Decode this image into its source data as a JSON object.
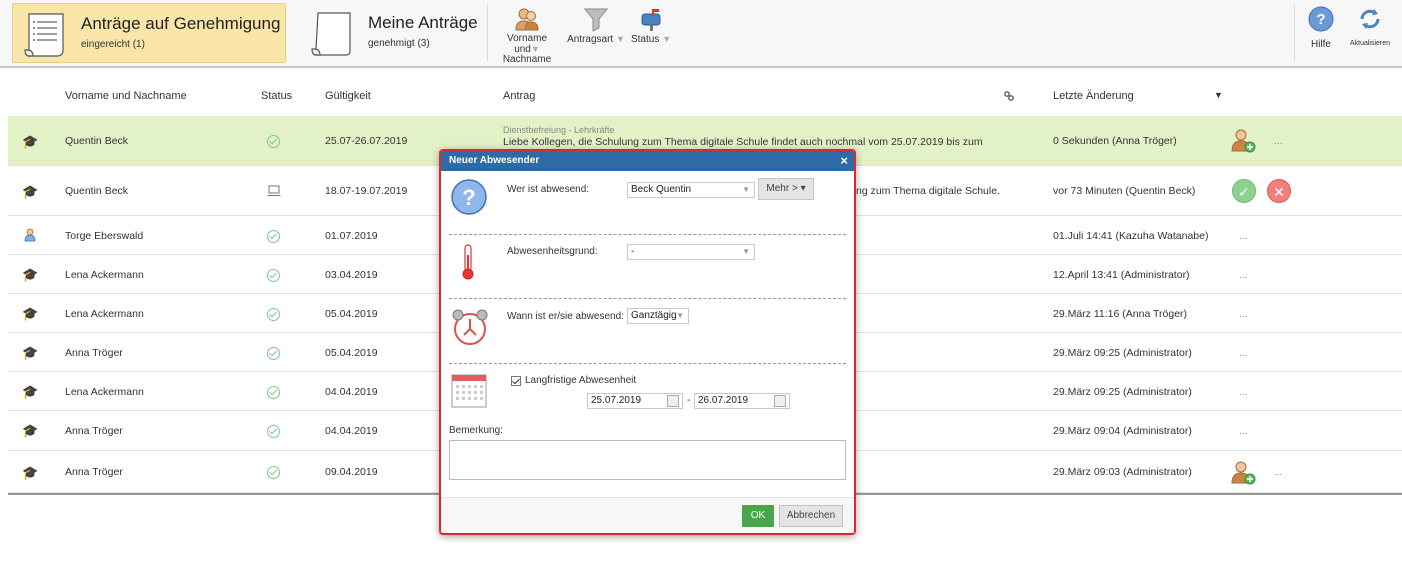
{
  "toolbar": {
    "tabs": [
      {
        "title": "Anträge auf Genehmigung",
        "sub": "eingereicht (1)"
      },
      {
        "title": "Meine Anträge",
        "sub": "genehmigt (3)"
      }
    ],
    "filters": [
      {
        "line1": "Vorname und",
        "line2": "Nachname"
      },
      {
        "line1": "Antragsart",
        "line2": ""
      },
      {
        "line1": "Status",
        "line2": ""
      }
    ],
    "help_label": "Hilfe",
    "refresh_label": "Aktualisieren"
  },
  "table": {
    "headers": {
      "name": "Vorname und Nachname",
      "status": "Status",
      "validity": "Gültigkeit",
      "request": "Antrag",
      "last_change": "Letzte Änderung"
    },
    "rows": [
      {
        "name": "Quentin Beck",
        "validity": "25.07-26.07.2019",
        "category": "Dienstbefreiung - Lehrkräfte",
        "request": "Liebe Kollegen, die Schulung zum Thema digitale Schule findet auch nochmal vom 25.07.2019 bis zum",
        "last_change": "0 Sekunden (Anna Tröger)"
      },
      {
        "name": "Quentin Beck",
        "validity": "18.07-19.07.2019",
        "category": "",
        "request": "ng zum Thema digitale Schule.",
        "last_change": "vor 73 Minuten (Quentin Beck)"
      },
      {
        "name": "Torge Eberswald",
        "validity": "01.07.2019",
        "category": "",
        "request": "",
        "last_change": "01.Juli 14:41 (Kazuha Watanabe)"
      },
      {
        "name": "Lena Ackermann",
        "validity": "03.04.2019",
        "category": "",
        "request": "",
        "last_change": "12.April 13:41 (Administrator)"
      },
      {
        "name": "Lena Ackermann",
        "validity": "05.04.2019",
        "category": "",
        "request": "",
        "last_change": "29.März 11:16 (Anna Tröger)"
      },
      {
        "name": "Anna Tröger",
        "validity": "05.04.2019",
        "category": "",
        "request": "",
        "last_change": "29.März 09:25 (Administrator)"
      },
      {
        "name": "Lena Ackermann",
        "validity": "04.04.2019",
        "category": "",
        "request": "",
        "last_change": "29.März 09:25 (Administrator)"
      },
      {
        "name": "Anna Tröger",
        "validity": "04.04.2019",
        "category": "",
        "request": "",
        "last_change": "29.März 09:04 (Administrator)"
      },
      {
        "name": "Anna Tröger",
        "validity": "09.04.2019",
        "category": "",
        "request": "",
        "last_change": "29.März 09:03 (Administrator)"
      }
    ],
    "more": "..."
  },
  "dialog": {
    "title": "Neuer Abwesender",
    "who_label": "Wer ist abwesend:",
    "who_value": "Beck Quentin",
    "more_button": "Mehr > ▾",
    "reason_label": "Abwesenheitsgrund:",
    "reason_value": "-",
    "when_label": "Wann ist er/sie abwesend:",
    "when_value": "Ganztägig",
    "longterm_label": "Langfristige Abwesenheit",
    "date_from": "25.07.2019",
    "date_sep": "-",
    "date_to": "26.07.2019",
    "remark_label": "Bemerkung:",
    "ok": "OK",
    "cancel": "Abbrechen"
  }
}
